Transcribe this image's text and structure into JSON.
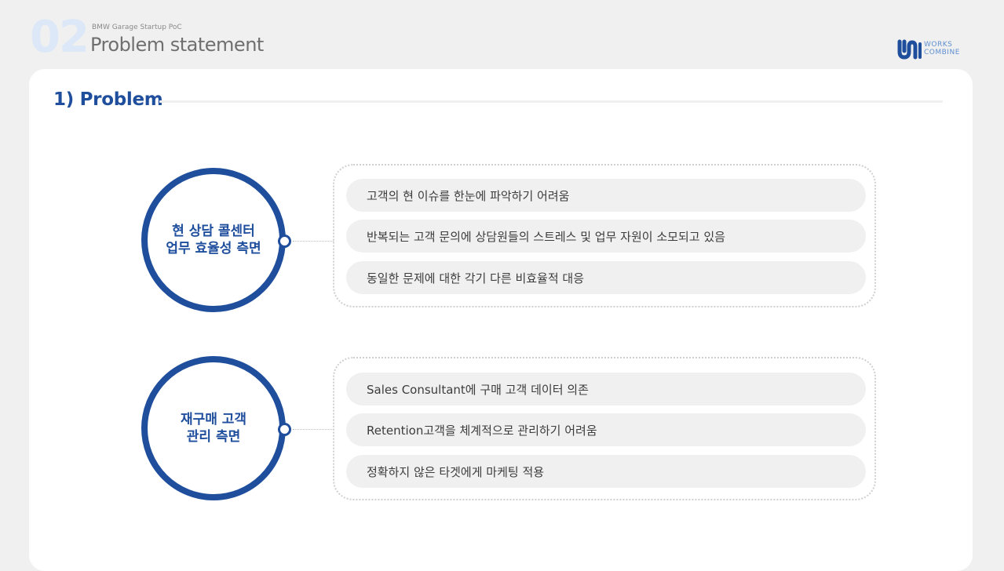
{
  "header": {
    "slide_number": "02",
    "subtitle": "BMW Garage Startup  PoC",
    "title": "Problem statement",
    "logo": {
      "line1": "WORKS",
      "line2": "COMBINE",
      "icon": "works-combine-logo-icon",
      "color": "#1f4e9d"
    }
  },
  "section": {
    "title": "1) Problem"
  },
  "groups": [
    {
      "label": "현 상담 콜센터\n업무 효율성 측면",
      "items": [
        "고객의 현 이슈를 한눈에 파악하기  어려움",
        "반복되는 고객 문의에 상담원들의 스트레스 및 업무 자원이 소모되고 있음",
        "동일한 문제에 대한 각기 다른 비효율적 대응"
      ]
    },
    {
      "label": "재구매 고객\n관리 측면",
      "items": [
        "Sales Consultant에 구매 고객 데이터 의존",
        "Retention고객을 체계적으로 관리하기 어려움",
        "정확하지 않은 타겟에게 마케팅 적용"
      ]
    }
  ],
  "colors": {
    "accent": "#1f4e9d",
    "pill_bg": "#f0f0f0",
    "text": "#3c3c3c"
  }
}
